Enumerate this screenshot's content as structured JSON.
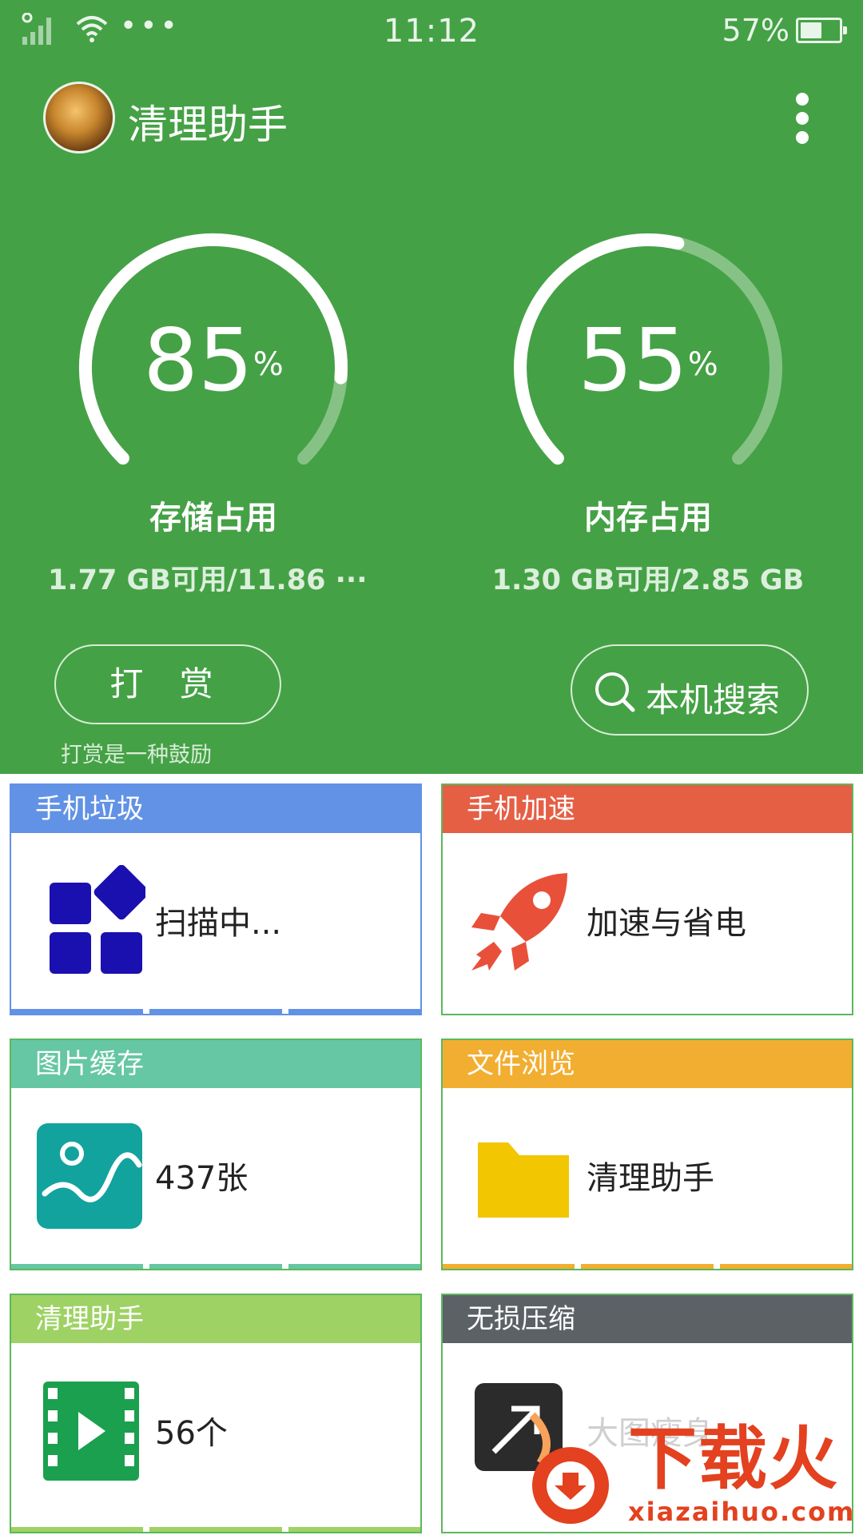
{
  "status_bar": {
    "time": "11:12",
    "battery_pct": "57%",
    "battery_level": 0.57,
    "dots": "•••"
  },
  "app_bar": {
    "title": "清理助手"
  },
  "gauges": {
    "storage": {
      "value": "85",
      "unit": "%",
      "level": 0.85,
      "label": "存储占用",
      "info": "1.77  GB可用/11.86  ···"
    },
    "memory": {
      "value": "55",
      "unit": "%",
      "level": 0.55,
      "label": "内存占用",
      "info": "1.30  GB可用/2.85  GB"
    }
  },
  "buttons": {
    "reward_label": "打 赏",
    "reward_sub": "打赏是一种鼓励",
    "search_label": "本机搜索"
  },
  "cards": [
    {
      "title": "手机垃圾",
      "text": "扫描中...",
      "icon": "apps-grid-icon"
    },
    {
      "title": "手机加速",
      "text": "加速与省电",
      "icon": "rocket-icon"
    },
    {
      "title": "图片缓存",
      "text": "437张",
      "icon": "picture-icon"
    },
    {
      "title": "文件浏览",
      "text": "清理助手",
      "icon": "folder-icon"
    },
    {
      "title": "清理助手",
      "text": "56个",
      "icon": "video-icon"
    },
    {
      "title": "无损压缩",
      "text": "大图瘦身",
      "icon": "compress-icon"
    }
  ],
  "watermark": {
    "brand": "下载火",
    "domain": "xiazaihuo.com"
  },
  "colors": {
    "top_bg": "#45a146",
    "blue": "#6192e5",
    "red": "#e55f45",
    "teal": "#65c7a3",
    "orange": "#f2ae30",
    "lime": "#9ed264",
    "slate": "#5c6166"
  }
}
